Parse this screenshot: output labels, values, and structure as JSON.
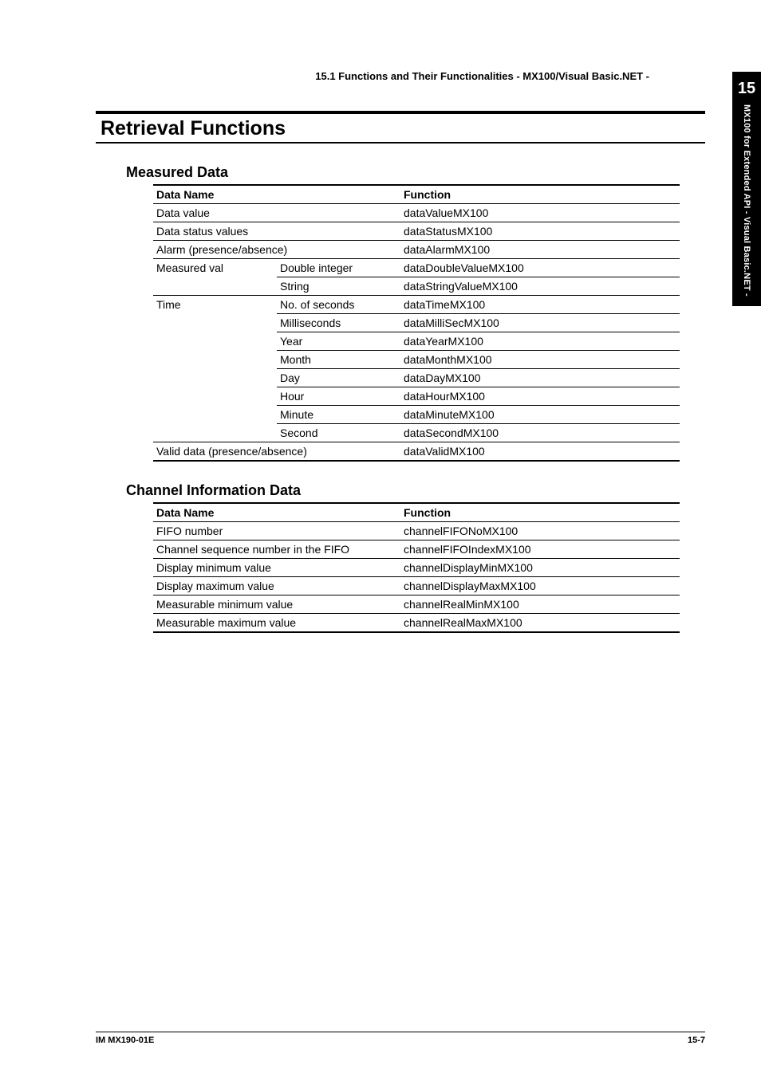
{
  "running_head": "15.1  Functions and Their Functionalities - MX100/Visual Basic.NET -",
  "thumb": {
    "chapter": "15",
    "vtext": "MX100 for Extended API - Visual Basic.NET -"
  },
  "h1": "Retrieval Functions",
  "sections": {
    "measured": {
      "title": "Measured Data",
      "head": {
        "name": "Data Name",
        "func": "Function"
      },
      "rows": [
        {
          "c1": "Data value",
          "c2": "",
          "c3": "dataValueMX100",
          "span12": true
        },
        {
          "c1": "Data status values",
          "c2": "",
          "c3": "dataStatusMX100",
          "span12": true
        },
        {
          "c1": "Alarm (presence/absence)",
          "c2": "",
          "c3": "dataAlarmMX100",
          "span12": true
        },
        {
          "c1": "Measured val",
          "c2": "Double integer",
          "c3": "dataDoubleValueMX100",
          "c1_noborder": true
        },
        {
          "c1": "",
          "c2": "String",
          "c3": "dataStringValueMX100"
        },
        {
          "c1": "Time",
          "c2": "No. of seconds",
          "c3": "dataTimeMX100",
          "c1_noborder": true
        },
        {
          "c1": "",
          "c2": "Milliseconds",
          "c3": "dataMilliSecMX100",
          "c1_noborder": true
        },
        {
          "c1": "",
          "c2": "Year",
          "c3": "dataYearMX100",
          "c1_noborder": true
        },
        {
          "c1": "",
          "c2": "Month",
          "c3": "dataMonthMX100",
          "c1_noborder": true
        },
        {
          "c1": "",
          "c2": "Day",
          "c3": "dataDayMX100",
          "c1_noborder": true
        },
        {
          "c1": "",
          "c2": "Hour",
          "c3": "dataHourMX100",
          "c1_noborder": true
        },
        {
          "c1": "",
          "c2": "Minute",
          "c3": "dataMinuteMX100",
          "c1_noborder": true
        },
        {
          "c1": "",
          "c2": "Second",
          "c3": "dataSecondMX100"
        },
        {
          "c1": "Valid data (presence/absence)",
          "c2": "",
          "c3": "dataValidMX100",
          "span12": true
        }
      ]
    },
    "channel": {
      "title": "Channel Information Data",
      "head": {
        "name": "Data Name",
        "func": "Function"
      },
      "rows": [
        {
          "c1": "FIFO number",
          "c3": "channelFIFONoMX100"
        },
        {
          "c1": "Channel sequence number in the FIFO",
          "c3": "channelFIFOIndexMX100"
        },
        {
          "c1": "Display minimum value",
          "c3": "channelDisplayMinMX100"
        },
        {
          "c1": "Display maximum value",
          "c3": "channelDisplayMaxMX100"
        },
        {
          "c1": "Measurable minimum value",
          "c3": "channelRealMinMX100"
        },
        {
          "c1": "Measurable maximum value",
          "c3": "channelRealMaxMX100"
        }
      ]
    }
  },
  "footer": {
    "left": "IM MX190-01E",
    "right": "15-7"
  }
}
